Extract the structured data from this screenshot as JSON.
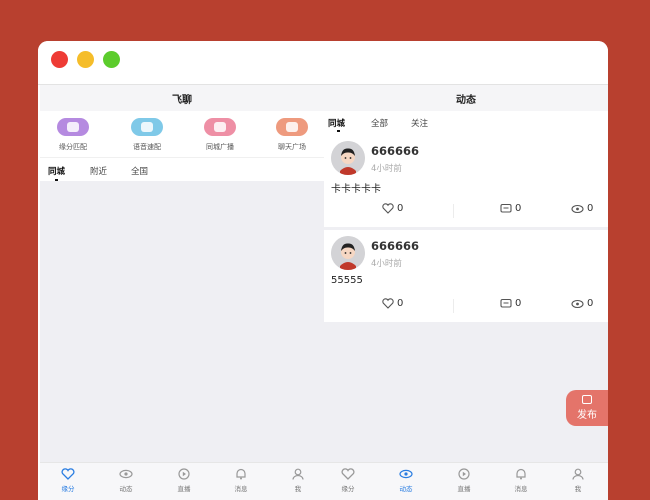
{
  "window": {
    "controls": [
      "close",
      "minimize",
      "zoom"
    ]
  },
  "left": {
    "title": "飞聊",
    "features": [
      {
        "label": "缘分匹配",
        "color": "#b58ae0"
      },
      {
        "label": "语音速配",
        "color": "#7fc9e8"
      },
      {
        "label": "同城广播",
        "color": "#ee8fa5"
      },
      {
        "label": "聊天广场",
        "color": "#ee9a7e"
      }
    ],
    "tabs": [
      "同城",
      "附近",
      "全国"
    ],
    "bottom_tabs": [
      "缘分",
      "动态",
      "直播",
      "消息",
      "我"
    ]
  },
  "right": {
    "title": "动态",
    "tabs": [
      "同城",
      "全部",
      "关注"
    ],
    "posts": [
      {
        "name": "666666",
        "time": "4小时前",
        "content": "卡卡卡卡卡",
        "likes": "0",
        "comments": "0",
        "views": "0"
      },
      {
        "name": "666666",
        "time": "4小时前",
        "content": "55555",
        "likes": "0",
        "comments": "0",
        "views": "0"
      }
    ],
    "bottom_tabs": [
      "缘分",
      "动态",
      "直播",
      "消息",
      "我"
    ],
    "publish_label": "发布"
  },
  "colors": {
    "accent": "#2a7de1",
    "fab": "#e4746a",
    "background": "#b8402f"
  }
}
